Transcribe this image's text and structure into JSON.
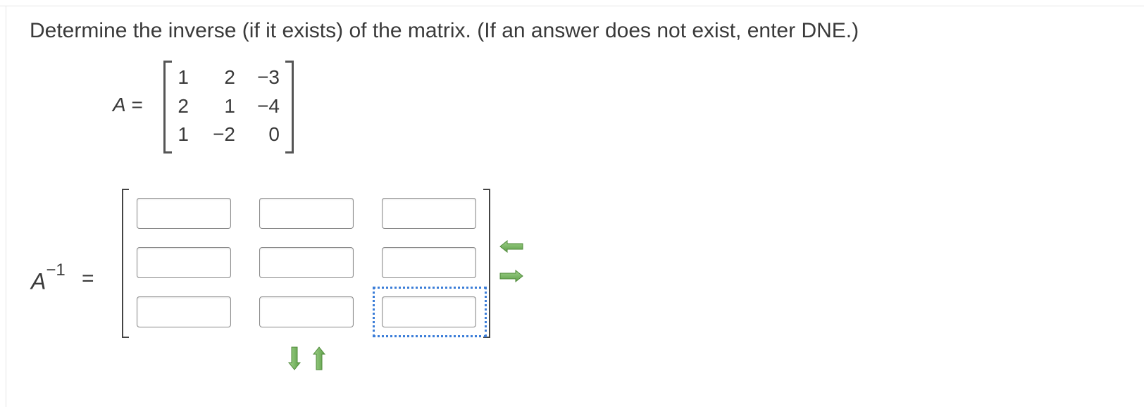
{
  "question": {
    "text": "Determine the inverse (if it exists) of the matrix. (If an answer does not exist, enter DNE.)"
  },
  "matrix_a": {
    "label": "A",
    "equals": "=",
    "rows": [
      [
        "1",
        "2",
        "−3"
      ],
      [
        "2",
        "1",
        "−4"
      ],
      [
        "1",
        "−2",
        "0"
      ]
    ]
  },
  "inverse": {
    "label": "A",
    "exponent": "−1",
    "equals": "=",
    "cells": [
      [
        "",
        "",
        ""
      ],
      [
        "",
        "",
        ""
      ],
      [
        "",
        "",
        ""
      ]
    ],
    "focused_cell": "row 3, column 3"
  },
  "controls": {
    "remove_column_icon": "arrow-left-icon",
    "add_column_icon": "arrow-right-icon",
    "add_row_icon": "arrow-down-icon",
    "remove_row_icon": "arrow-up-icon",
    "arrow_color": "#6aa84f"
  }
}
